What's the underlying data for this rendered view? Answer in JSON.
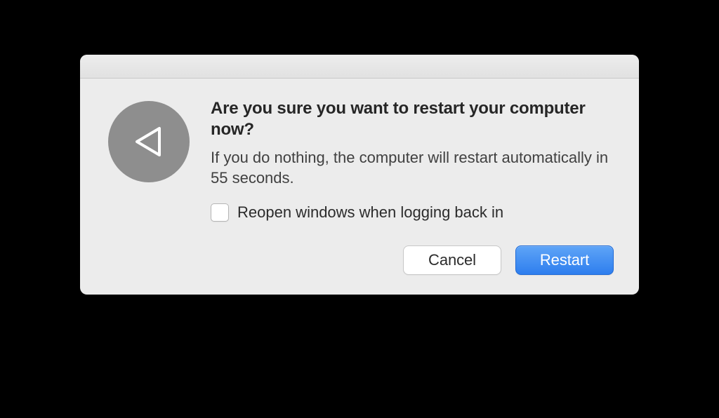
{
  "dialog": {
    "title": "Are you sure you want to restart your computer now?",
    "message": "If you do nothing, the computer will restart automatically in 55 seconds.",
    "countdown_seconds": 55,
    "checkbox": {
      "label": "Reopen windows when logging back in",
      "checked": false
    },
    "buttons": {
      "cancel": "Cancel",
      "confirm": "Restart"
    },
    "icon": "restart-triangle-icon"
  },
  "colors": {
    "accent": "#3a86f0",
    "window_bg": "#ececec",
    "icon_bg": "#8e8e8e"
  }
}
